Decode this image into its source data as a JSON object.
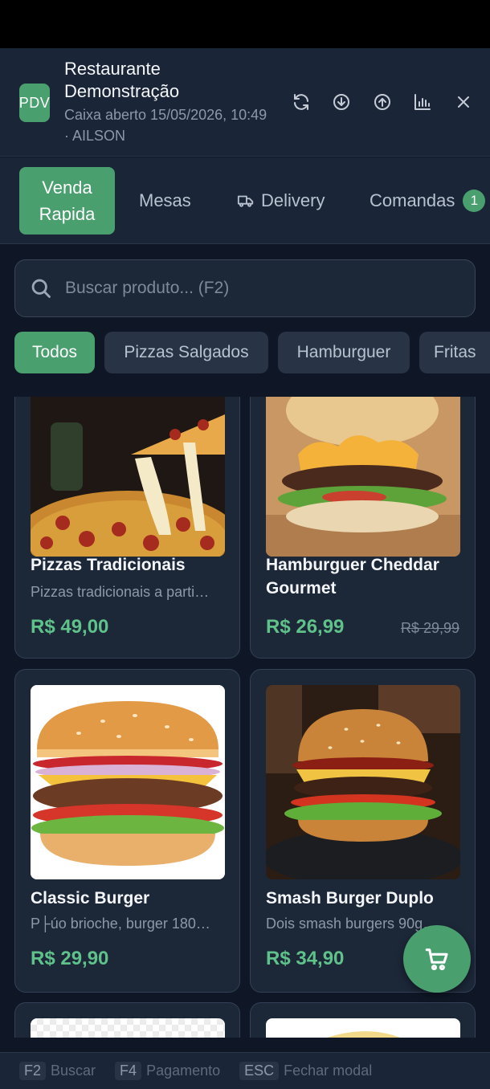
{
  "header": {
    "logo": "PDV",
    "title": "Restaurante Demonstração",
    "subtitle": "Caixa aberto 15/05/2026, 10:49 · AILSON",
    "icons": [
      "refresh-icon",
      "download-icon",
      "upload-icon",
      "chart-icon",
      "close-icon"
    ]
  },
  "tabs": [
    {
      "label": "Venda Rapida",
      "active": true
    },
    {
      "label": "Mesas"
    },
    {
      "label": "Delivery",
      "icon": "truck-icon"
    },
    {
      "label": "Comandas",
      "badge": "1"
    }
  ],
  "search": {
    "placeholder": "Buscar produto... (F2)",
    "value": ""
  },
  "categories": [
    {
      "label": "Todos",
      "active": true
    },
    {
      "label": "Pizzas Salgados"
    },
    {
      "label": "Hamburguer"
    },
    {
      "label": "Fritas"
    }
  ],
  "products": [
    {
      "name": "Pizzas Tradicionais",
      "description": "Pizzas tradicionais a parti…",
      "price": "R$ 49,00",
      "old_price": ""
    },
    {
      "name": "Hamburguer Cheddar Gourmet",
      "description": "",
      "price": "R$ 26,99",
      "old_price": "R$ 29,99"
    },
    {
      "name": "Classic Burger",
      "description": "P├úo brioche, burger 180…",
      "price": "R$ 29,90",
      "old_price": ""
    },
    {
      "name": "Smash Burger Duplo",
      "description": "Dois smash burgers 90g…",
      "price": "R$ 34,90",
      "old_price": ""
    }
  ],
  "cart": {
    "icon": "cart-icon"
  },
  "footer": [
    {
      "key": "F2",
      "label": "Buscar"
    },
    {
      "key": "F4",
      "label": "Pagamento"
    },
    {
      "key": "ESC",
      "label": "Fechar modal"
    }
  ],
  "colors": {
    "accent": "#4a9f6f",
    "price": "#5fc28a",
    "background": "#0f1726",
    "panel": "#1a2537"
  }
}
